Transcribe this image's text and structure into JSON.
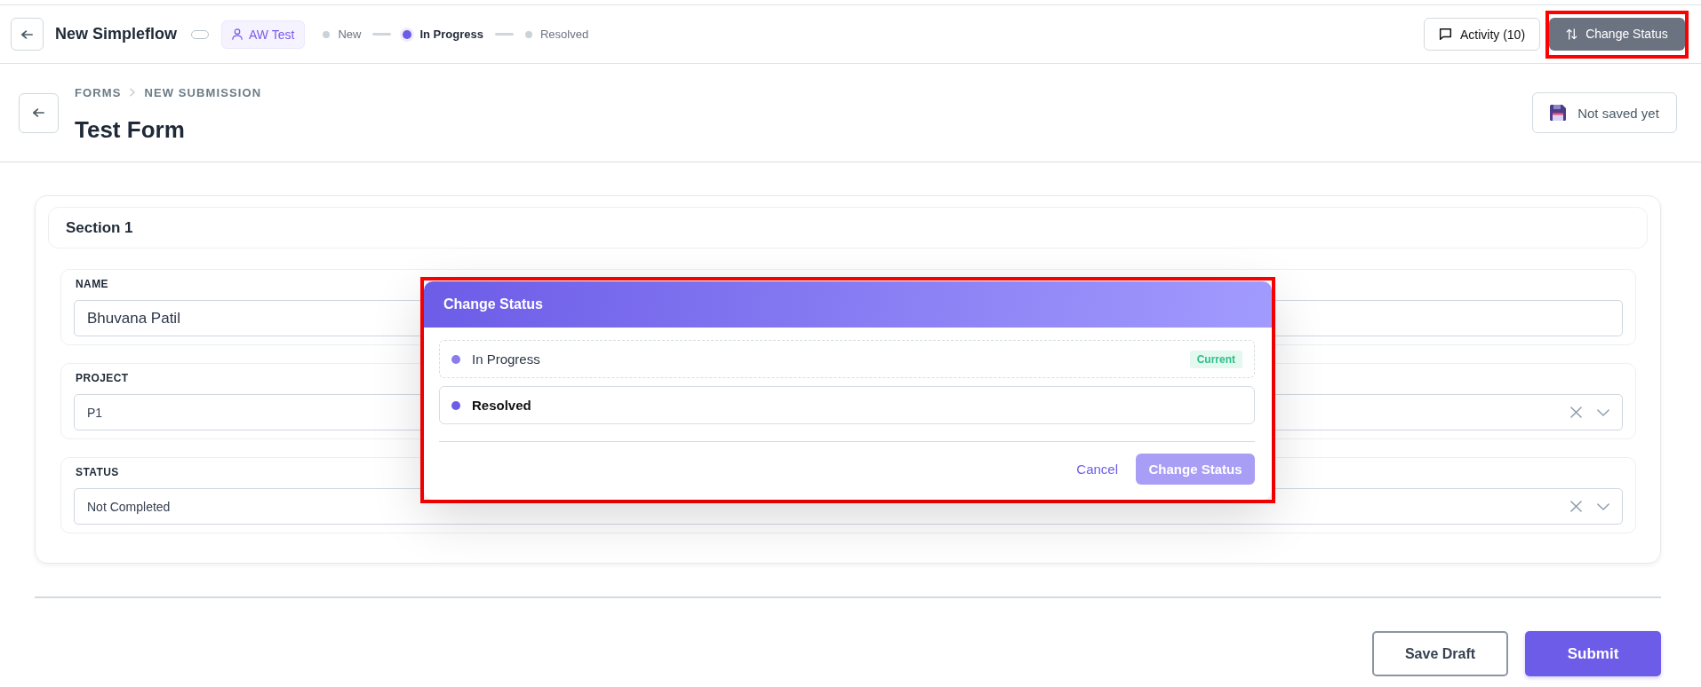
{
  "top_bar": {
    "title": "New Simpleflow",
    "toggle": {
      "on": false
    },
    "assignee": "AW Test",
    "steps": [
      {
        "label": "New",
        "current": false
      },
      {
        "label": "In Progress",
        "current": true
      },
      {
        "label": "Resolved",
        "current": false
      }
    ],
    "activity_button": {
      "label": "Activity (10)"
    },
    "change_status_button": {
      "label": "Change Status",
      "highlighted": true
    }
  },
  "header": {
    "breadcrumb": [
      "FORMS",
      "NEW SUBMISSION"
    ],
    "title": "Test Form",
    "save_status": "Not saved yet"
  },
  "form": {
    "section_title": "Section 1",
    "fields": [
      {
        "kind": "text",
        "label": "NAME",
        "value": "Bhuvana Patil"
      },
      {
        "kind": "select",
        "label": "PROJECT",
        "value": "P1"
      },
      {
        "kind": "select",
        "label": "STATUS",
        "value": "Not Completed"
      }
    ]
  },
  "actions": {
    "save_draft": "Save Draft",
    "submit": "Submit"
  },
  "dialog": {
    "title": "Change Status",
    "highlighted": true,
    "options": [
      {
        "label": "In Progress",
        "current": true,
        "badge": "Current",
        "selected": false
      },
      {
        "label": "Resolved",
        "current": false,
        "selected": false
      }
    ],
    "cancel": "Cancel",
    "confirm": {
      "label": "Change Status",
      "disabled": true
    }
  }
}
